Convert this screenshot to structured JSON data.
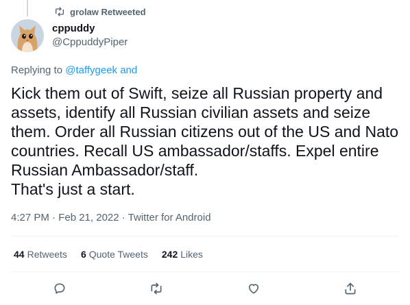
{
  "retweet_banner": {
    "text": "grolaw Retweeted"
  },
  "author": {
    "name": "cppuddy",
    "handle": "@CppuddyPiper"
  },
  "reply_context": {
    "prefix": "Replying to ",
    "user": "@taffygeek",
    "suffix": " and"
  },
  "tweet": {
    "text": "Kick them out of Swift, seize all Russian property and\nassets, identify all Russian civilian assets and seize\nthem. Order all Russian citizens out of the US and Nato\ncountries. Recall US ambassador/staffs. Expel entire\nRussian Ambassador/staff.\nThat's just a start."
  },
  "meta": {
    "text": "4:27 PM · Feb 21, 2022 · Twitter for Android"
  },
  "stats": {
    "retweets_count": "44",
    "retweets_label": "Retweets",
    "quotes_count": "6",
    "quotes_label": "Quote Tweets",
    "likes_count": "242",
    "likes_label": "Likes"
  },
  "actions": [
    "reply-icon",
    "retweet-icon",
    "like-icon",
    "share-icon"
  ],
  "colors": {
    "link": "#1d9bf0",
    "secondary_text": "#536471",
    "divider": "#eff3f4"
  }
}
